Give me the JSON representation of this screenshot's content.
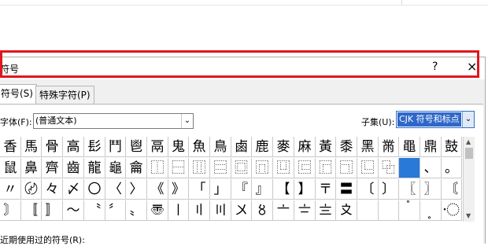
{
  "dialog": {
    "title": "符号",
    "help_label": "?",
    "close_label": "×"
  },
  "tabs": [
    {
      "label": "符号(S)",
      "active": true
    },
    {
      "label": "特殊字符(P)",
      "active": false
    }
  ],
  "font": {
    "label": "字体(F):",
    "value": "(普通文本)",
    "arrow": "⌄"
  },
  "subset": {
    "label": "子集(U):",
    "value": "CJK 符号和标点",
    "arrow": "⌄"
  },
  "grid": {
    "rows": [
      [
        "香",
        "馬",
        "骨",
        "高",
        "髟",
        "鬥",
        "鬯",
        "鬲",
        "鬼",
        "魚",
        "鳥",
        "鹵",
        "鹿",
        "麥",
        "麻",
        "黃",
        "黍",
        "黑",
        "黹",
        "黽",
        "鼎",
        "鼓"
      ],
      [
        "鼠",
        "鼻",
        "齊",
        "齒",
        "龍",
        "龜",
        "龠",
        "⿰",
        "⿱",
        "⿲",
        "⿳",
        "⿴",
        "⿵",
        "⿶",
        "⿷",
        "⿸",
        "⿹",
        "⿺",
        "⿻",
        "",
        "、",
        "。"
      ],
      [
        "〃",
        "〄",
        "々",
        "〆",
        "〇",
        "〈",
        "〉",
        "《",
        "》",
        "「",
        "」",
        "『",
        "』",
        "【",
        "】",
        "〒",
        "〓",
        "〔",
        "〕",
        "〖",
        "〗",
        "〘"
      ],
      [
        "〙",
        "〚",
        "〛",
        "〜",
        "〝",
        "〞",
        "〟",
        "〠",
        "〡",
        "〢",
        "〣",
        "〤",
        "〥",
        "〦",
        "〧",
        "〨",
        "〩",
        "〪",
        "〫",
        "〬",
        "〭",
        "〮"
      ]
    ],
    "selected_row": 1,
    "selected_col": 19
  },
  "scrollbar": {
    "up": "▲",
    "down": "▼"
  },
  "recent": {
    "label": "近期使用过的符号(R):"
  },
  "colors": {
    "highlight": "#e0161c",
    "selection": "#2979d9",
    "accent": "#2f67c9"
  }
}
